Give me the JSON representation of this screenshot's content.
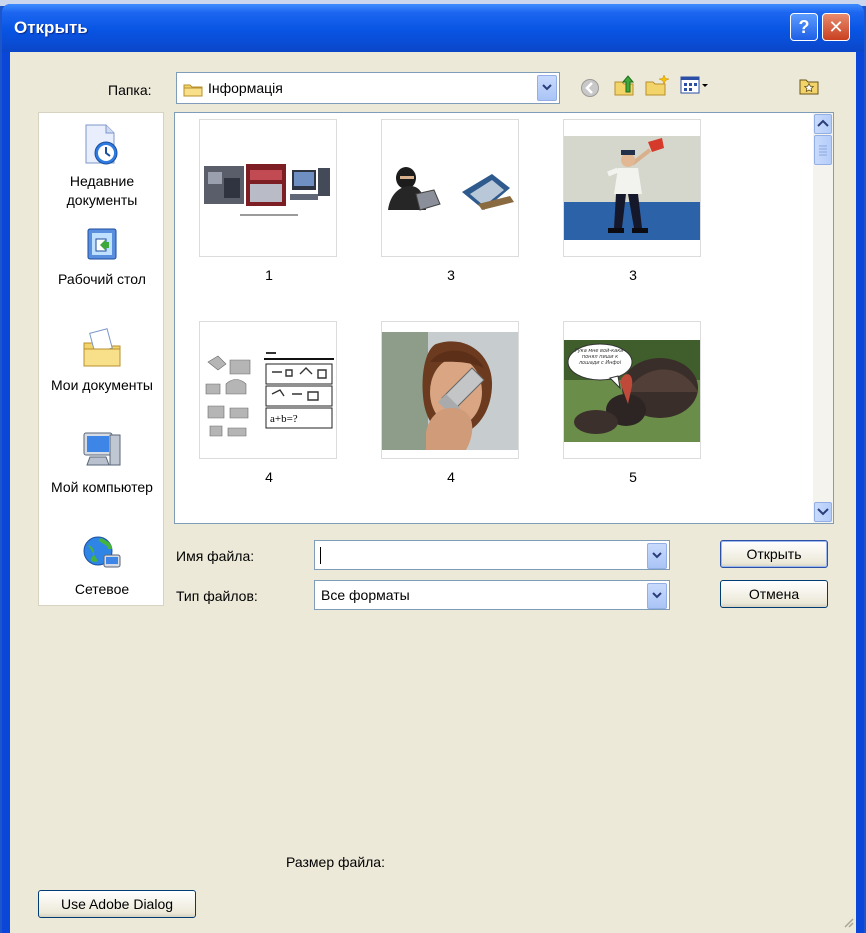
{
  "window": {
    "title": "Открыть",
    "help_label": "?",
    "close_label": "✕"
  },
  "toolbar": {
    "folder_label": "Папка:",
    "folder_value": "Інформація",
    "icons": [
      "back-icon",
      "up-folder-icon",
      "new-folder-icon",
      "views-menu-icon",
      "favorites-icon"
    ]
  },
  "places": [
    {
      "label": "Недавние документы",
      "icon": "recent-documents-icon"
    },
    {
      "label": "Рабочий стол",
      "icon": "desktop-icon"
    },
    {
      "label": "Мои документы",
      "icon": "my-documents-icon"
    },
    {
      "label": "Мой компьютер",
      "icon": "my-computer-icon"
    },
    {
      "label": "Сетевое",
      "icon": "network-icon"
    }
  ],
  "files": [
    {
      "caption": "1"
    },
    {
      "caption": "3"
    },
    {
      "caption": "3"
    },
    {
      "caption": "4"
    },
    {
      "caption": "4"
    },
    {
      "caption": "5"
    }
  ],
  "thumb_texts": {
    "formula": "a+b=?",
    "speech": "Рука мне вой-каки-понял пиши к лошади с Инфоі"
  },
  "form": {
    "filename_label": "Имя файла:",
    "filename_value": "",
    "filetype_label": "Тип файлов:",
    "filetype_value": "Все форматы",
    "open_label": "Открыть",
    "cancel_label": "Отмена",
    "size_label": "Размер файла:",
    "adobe_label": "Use Adobe Dialog"
  },
  "colors": {
    "titlebar": "#0854e3",
    "client": "#ece9d8",
    "accent_border": "#7f9db9"
  }
}
